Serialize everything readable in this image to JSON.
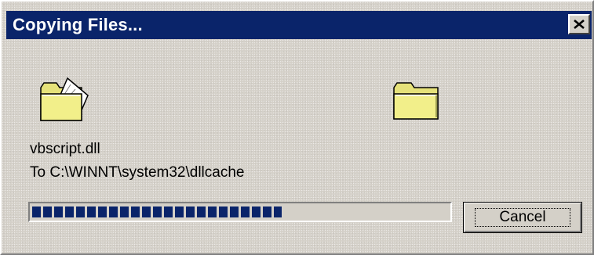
{
  "dialog": {
    "title": "Copying Files...",
    "close_icon": "close-icon"
  },
  "animation": {
    "source_icon": "folder-with-flying-document-icon",
    "destination_icon": "folder-icon"
  },
  "copy": {
    "file_name": "vbscript.dll",
    "destination": "To C:\\WINNT\\system32\\dllcache",
    "progress_fraction": 0.6
  },
  "buttons": {
    "cancel_label": "Cancel"
  },
  "colors": {
    "titlebar": "#0a246a",
    "title_text": "#ffffff",
    "window_face": "#d4d0c8",
    "progress_blocks": "#0a246a",
    "folder_yellow": "#f2ef8a"
  }
}
